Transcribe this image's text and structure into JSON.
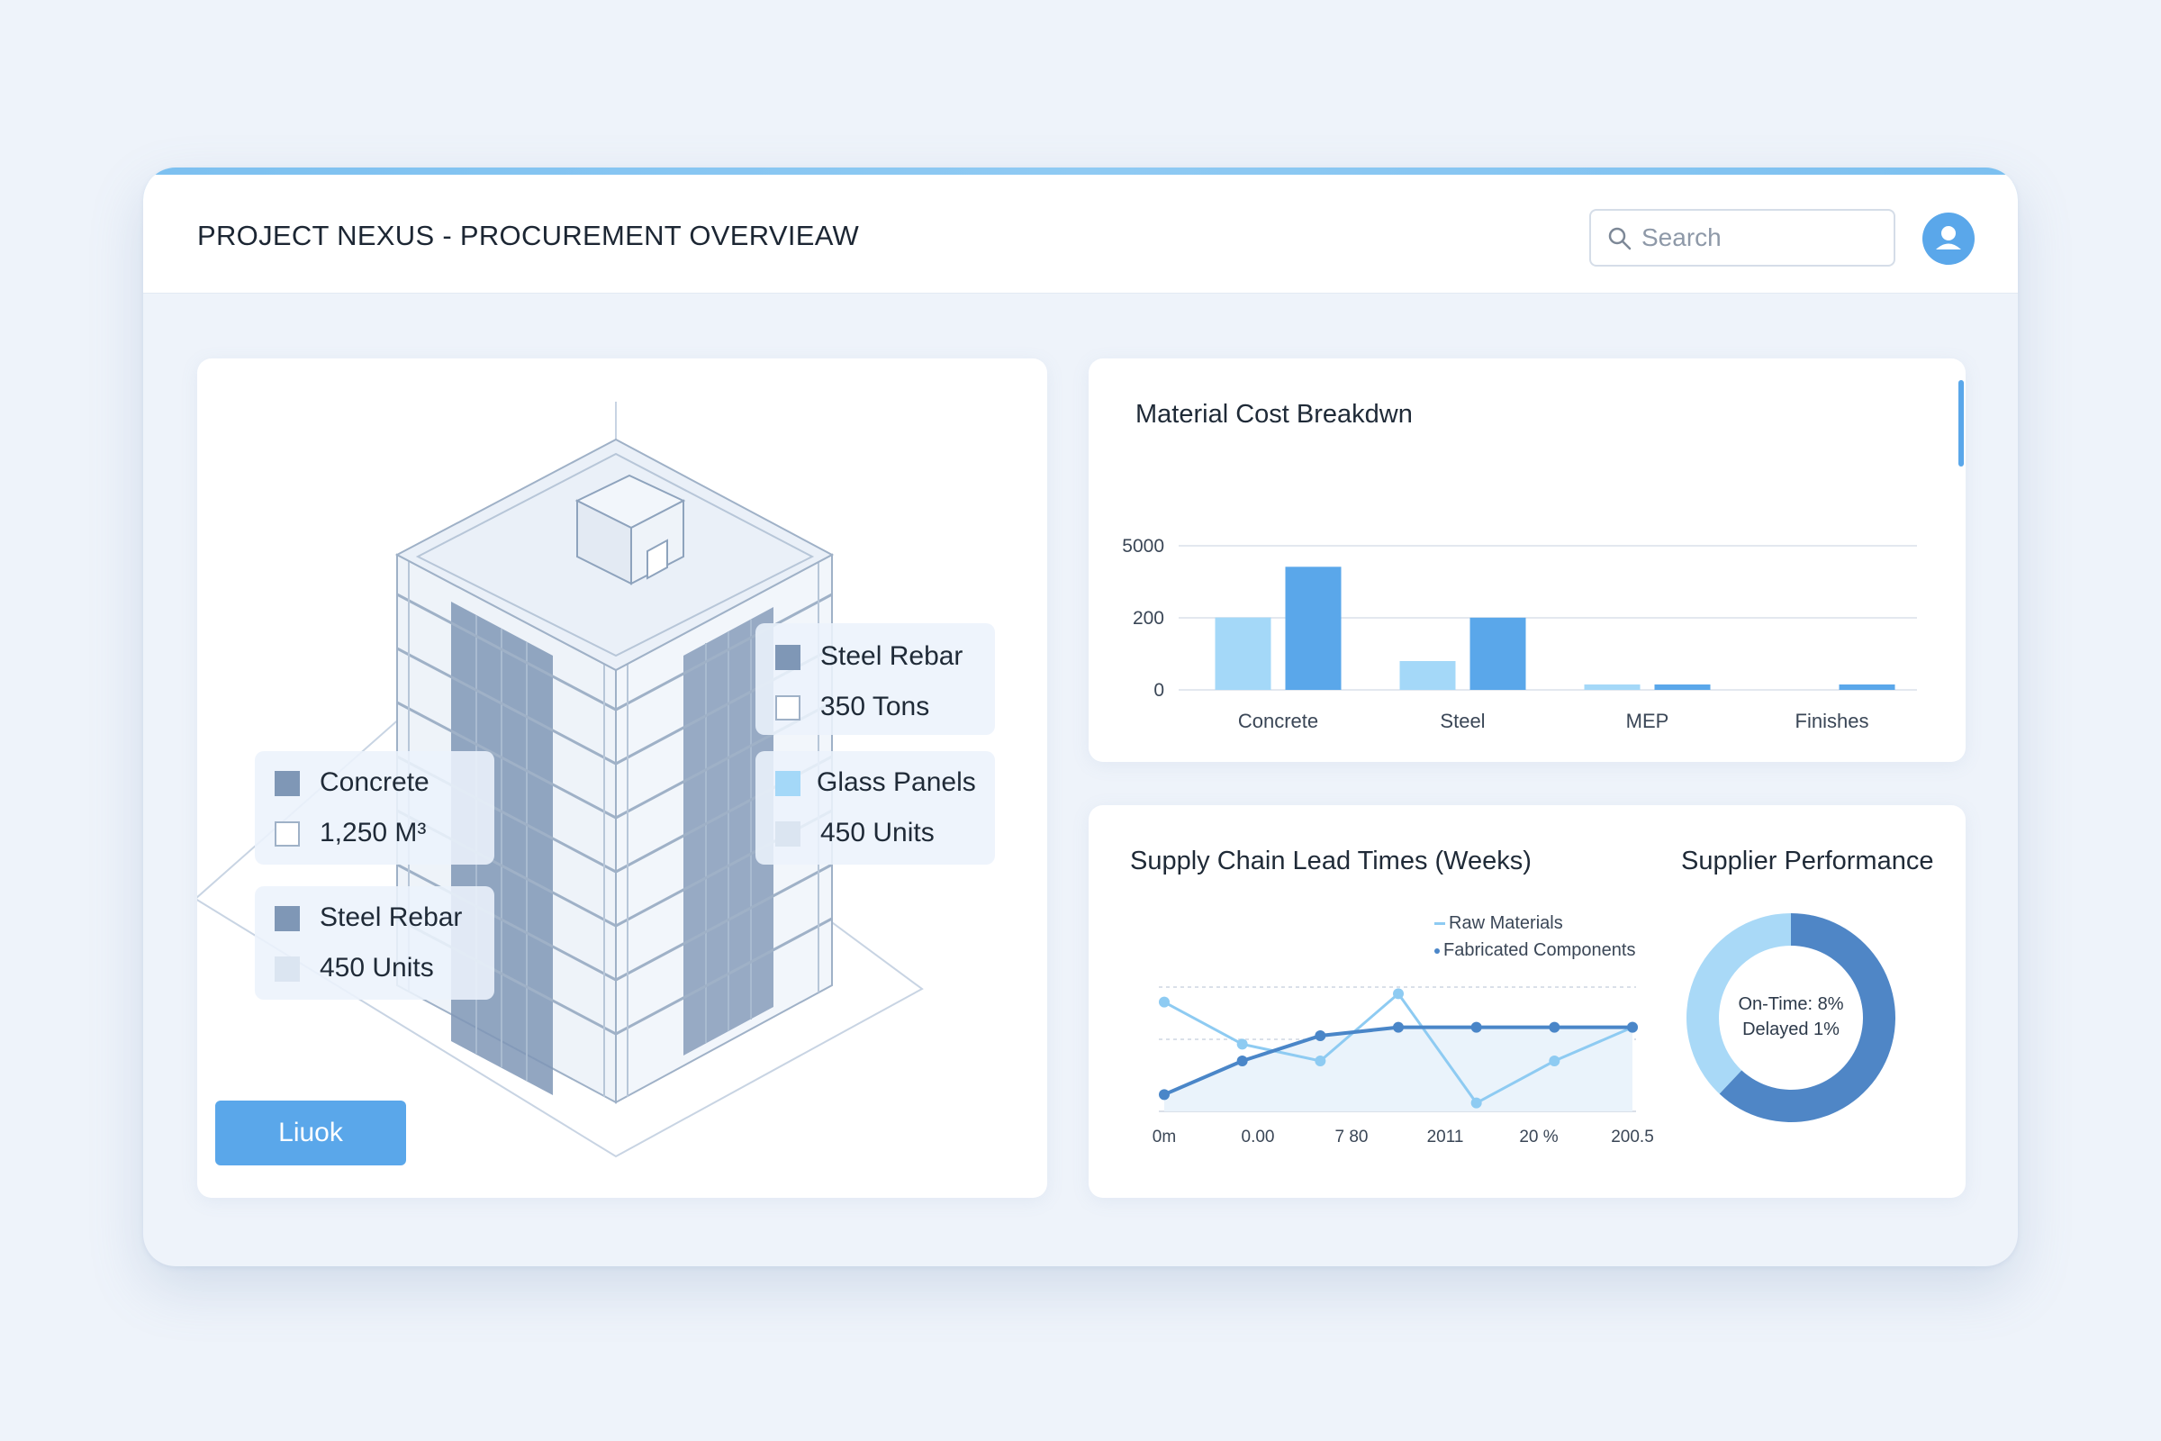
{
  "header": {
    "title": "PROJECT NEXUS - PROCUREMENT OVERVIEAW",
    "search_placeholder": "Search",
    "icons": {
      "search": "search-icon",
      "avatar": "user-icon"
    }
  },
  "model_panel": {
    "callouts": [
      {
        "title": "Steel Rebar",
        "value": "350 Tons",
        "color_title": "#7f97b6",
        "color_value": "#ffffff"
      },
      {
        "title": "Glass Panels",
        "value": "450 Units",
        "color_title": "#a4d8f8",
        "color_value": "#dbe5f1"
      },
      {
        "title": "Concrete",
        "value": "1,250 M³",
        "color_title": "#7f97b6",
        "color_value": "#ffffff"
      },
      {
        "title": "Steel Rebar",
        "value": "450 Units",
        "color_title": "#7f97b6",
        "color_value": "#dbe5f1"
      }
    ],
    "button_label": "Liuok"
  },
  "cost_panel": {
    "title": "Material Cost Breakdwn"
  },
  "supply_panel": {
    "title": "Supply Chain Lead Times (Weeks)",
    "performance_title": "Supplier Performance",
    "legend": [
      "Raw Materials",
      "Fabricated Components"
    ],
    "donut_on_time": "On-Time: 8%",
    "donut_delayed": "Delayed 1%"
  },
  "colors": {
    "accent": "#5aa7ea",
    "light_series": "#a4d8f8",
    "dark_series": "#5aa7ea",
    "line_dark": "#4a86c8",
    "line_light": "#8ecbf2",
    "donut_dark": "#4f86c6",
    "donut_light": "#a9d9f7"
  },
  "chart_data": [
    {
      "type": "bar",
      "title": "Material Cost Breakdwn",
      "categories": [
        "Concrete",
        "Steel",
        "MEP",
        "Finishes"
      ],
      "yticks": [
        "0",
        "200",
        "5000"
      ],
      "series": [
        {
          "values": [
            220,
            80,
            10,
            0
          ]
        },
        {
          "values": [
            3600,
            210,
            10,
            5
          ]
        }
      ],
      "grid": true,
      "legend": "none"
    },
    {
      "type": "line",
      "title": "Supply Chain Lead Times (Weeks)",
      "xticks": [
        "0m",
        "0.00",
        "7 80",
        "2011",
        "20 %",
        "200.5"
      ],
      "series": [
        {
          "name": "Raw Materials",
          "values": [
            2,
            6,
            9,
            10,
            10,
            10,
            10
          ]
        },
        {
          "name": "Fabricated Components",
          "values": [
            13,
            8,
            6,
            14,
            1,
            6,
            10
          ]
        }
      ],
      "grid": true,
      "legend": "top-right"
    },
    {
      "type": "pie",
      "title": "Supplier Performance",
      "slices": [
        {
          "label": "On-Time: 8%",
          "value": 62
        },
        {
          "label": "Delayed 1%",
          "value": 38
        }
      ]
    }
  ]
}
